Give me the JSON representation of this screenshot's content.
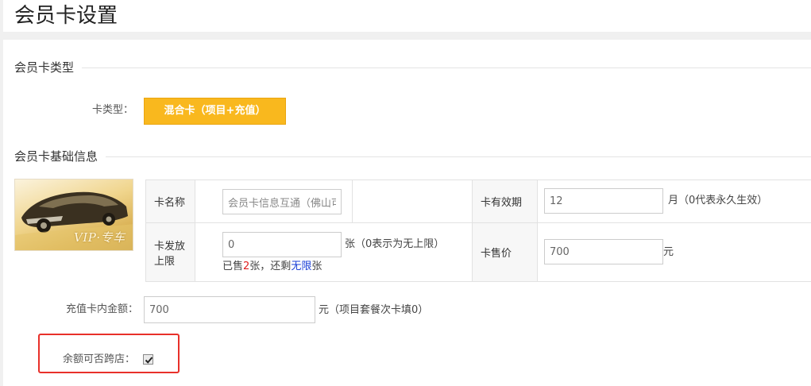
{
  "header": {
    "title": "会员卡设置"
  },
  "section_type": {
    "title": "会员卡类型",
    "card_type_label": "卡类型：",
    "card_type_value": "混合卡（项目+充值）"
  },
  "section_basic": {
    "title": "会员卡基础信息",
    "card_image": {
      "icon": "car-card-image",
      "text": "VIP·专车"
    },
    "name_label": "卡名称",
    "name_value": "会员卡信息互通（佛山可",
    "validity_label": "卡有效期",
    "validity_value": "12",
    "validity_note": "月（0代表永久生效）",
    "limit_label": "卡发放上限",
    "limit_value": "0",
    "limit_note": "张（0表示为无上限）",
    "sold": {
      "prefix": "已售",
      "count": "2",
      "mid": "张，还剩",
      "remain": "无限",
      "suffix": "张"
    },
    "price_label": "卡售价",
    "price_value": "700",
    "price_unit": "元",
    "amount_label": "充值卡内金额：",
    "amount_value": "700",
    "amount_note": "元（项目套餐次卡填0）",
    "cross_store_label": "余额可否跨店：",
    "cross_store_checked": true
  },
  "colors": {
    "accent": "#f9b81e",
    "highlight": "#e8302a",
    "sold_count": "#e02020",
    "remain": "#1a3fd6"
  }
}
